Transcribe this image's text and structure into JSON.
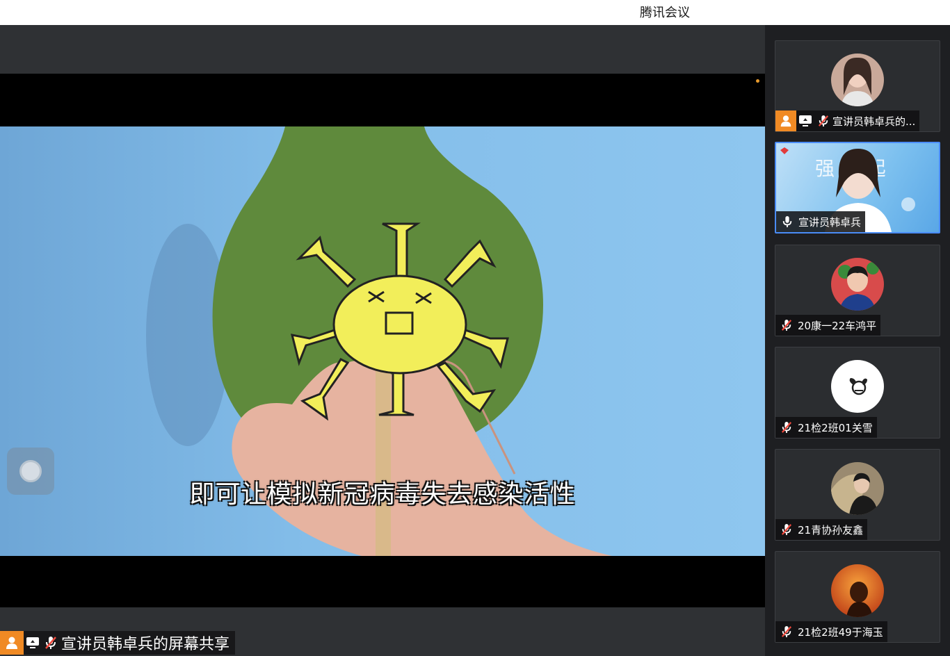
{
  "window": {
    "title": "腾讯会议"
  },
  "share": {
    "subtitle": "即可让模拟新冠病毒失去感染活性",
    "label": "宣讲员韩卓兵的屏幕共享",
    "float_button": "floating-control"
  },
  "participants": [
    {
      "name": "宣讲员韩卓兵的...",
      "host": true,
      "sharing": true,
      "mic": "muted"
    },
    {
      "name": "宣讲员韩卓兵",
      "video": true,
      "mic": "on",
      "video_text": "强 核 起"
    },
    {
      "name": "20康一22车鸿平",
      "mic": "muted"
    },
    {
      "name": "21检2班01关雪",
      "mic": "muted"
    },
    {
      "name": "21青协孙友鑫",
      "mic": "muted"
    },
    {
      "name": "21检2班49于海玉",
      "mic": "muted"
    }
  ],
  "colors": {
    "accent_orange": "#f08a24",
    "active_border": "#4a8cf7"
  }
}
